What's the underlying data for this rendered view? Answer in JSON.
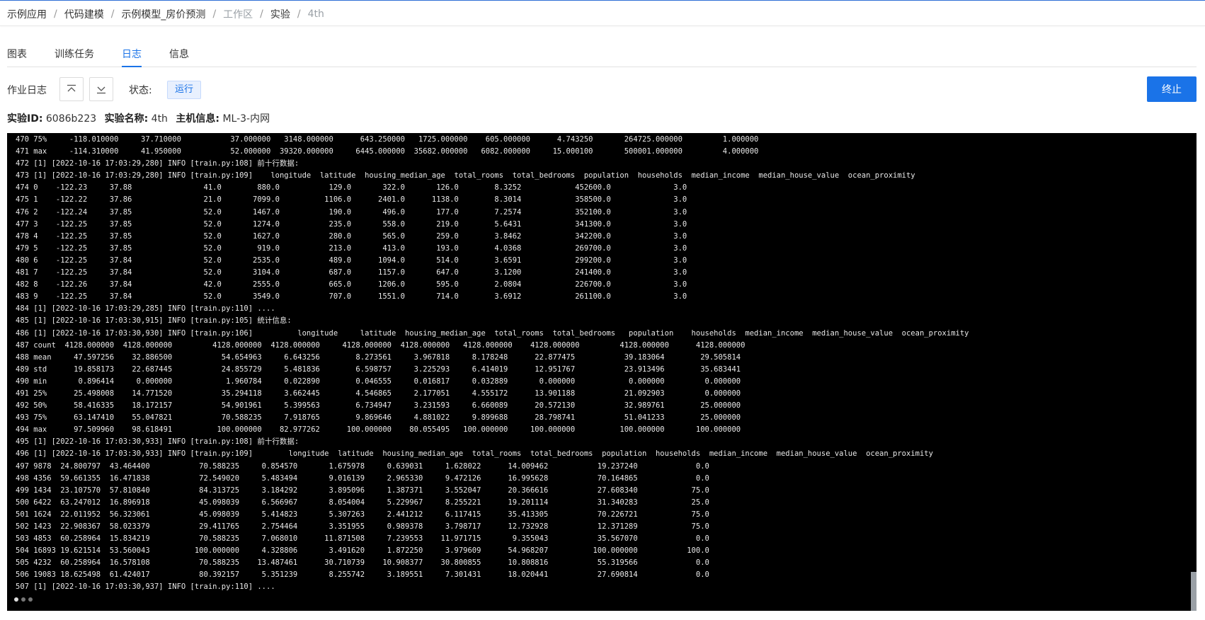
{
  "breadcrumb": [
    {
      "label": "示例应用",
      "muted": false
    },
    {
      "label": "代码建模",
      "muted": false
    },
    {
      "label": "示例模型_房价预测",
      "muted": false
    },
    {
      "label": "工作区",
      "muted": true
    },
    {
      "label": "实验",
      "muted": false
    },
    {
      "label": "4th",
      "muted": true
    }
  ],
  "breadcrumb_separator": "/",
  "tabs": [
    {
      "label": "图表",
      "active": false
    },
    {
      "label": "训练任务",
      "active": false
    },
    {
      "label": "日志",
      "active": true
    },
    {
      "label": "信息",
      "active": false
    }
  ],
  "toolbar": {
    "job_log_label": "作业日志",
    "scroll_top_icon": "scroll-to-top-icon",
    "scroll_bottom_icon": "scroll-to-bottom-icon",
    "status_label": "状态:",
    "status_value": "运行",
    "stop_label": "终止"
  },
  "experiment": {
    "id_label": "实验ID:",
    "id": "6086b223",
    "name_label": "实验名称:",
    "name": "4th",
    "host_label": "主机信息:",
    "host": "ML-3-内网"
  },
  "colors": {
    "accent": "#1a73e8",
    "console_bg": "#000000",
    "console_text": "#e8e8e8"
  },
  "log_lines": [
    "470 75%     -118.010000     37.710000           37.000000   3148.000000      643.250000   1725.000000    605.000000      4.743250       264725.000000         1.000000",
    "471 max     -114.310000     41.950000           52.000000  39320.000000     6445.000000  35682.000000   6082.000000     15.000100       500001.000000         4.000000",
    "472 [1] [2022-10-16 17:03:29,280] INFO [train.py:108] 前十行数据:",
    "473 [1] [2022-10-16 17:03:29,280] INFO [train.py:109]    longitude  latitude  housing_median_age  total_rooms  total_bedrooms  population  households  median_income  median_house_value  ocean_proximity",
    "474 0    -122.23     37.88                41.0        880.0           129.0       322.0       126.0        8.3252            452600.0              3.0",
    "475 1    -122.22     37.86                21.0       7099.0          1106.0      2401.0      1138.0        8.3014            358500.0              3.0",
    "476 2    -122.24     37.85                52.0       1467.0           190.0       496.0       177.0        7.2574            352100.0              3.0",
    "477 3    -122.25     37.85                52.0       1274.0           235.0       558.0       219.0        5.6431            341300.0              3.0",
    "478 4    -122.25     37.85                52.0       1627.0           280.0       565.0       259.0        3.8462            342200.0              3.0",
    "479 5    -122.25     37.85                52.0        919.0           213.0       413.0       193.0        4.0368            269700.0              3.0",
    "480 6    -122.25     37.84                52.0       2535.0           489.0      1094.0       514.0        3.6591            299200.0              3.0",
    "481 7    -122.25     37.84                52.0       3104.0           687.0      1157.0       647.0        3.1200            241400.0              3.0",
    "482 8    -122.26     37.84                42.0       2555.0           665.0      1206.0       595.0        2.0804            226700.0              3.0",
    "483 9    -122.25     37.84                52.0       3549.0           707.0      1551.0       714.0        3.6912            261100.0              3.0",
    "484 [1] [2022-10-16 17:03:29,285] INFO [train.py:110] ....",
    "485 [1] [2022-10-16 17:03:30,915] INFO [train.py:105] 统计信息:",
    "486 [1] [2022-10-16 17:03:30,930] INFO [train.py:106]          longitude     latitude  housing_median_age  total_rooms  total_bedrooms   population    households  median_income  median_house_value  ocean_proximity",
    "487 count  4128.000000  4128.000000         4128.000000  4128.000000     4128.000000  4128.000000   4128.000000    4128.000000         4128.000000      4128.000000",
    "488 mean     47.597256    32.886500           54.654963     6.643256        8.273561     3.967818     8.178248      22.877475           39.183064        29.505814",
    "489 std      19.858173    22.687445           24.855729     5.481836        6.598757     3.225293     6.414019      12.951767           23.913496        35.683441",
    "490 min       0.896414     0.000000            1.960784     0.022890        0.046555     0.016817     0.032889       0.000000            0.000000         0.000000",
    "491 25%      25.498008    14.771520           35.294118     3.662445        4.546865     2.177051     4.555172      13.901188           21.092903         0.000000",
    "492 50%      58.416335    18.172157           54.901961     5.399563        6.734947     3.231593     6.660089      20.572130           32.989761        25.000000",
    "493 75%      63.147410    55.047821           70.588235     7.918765        9.869646     4.881022     9.899688      28.798741           51.041233        25.000000",
    "494 max      97.509960    98.618491          100.000000    82.977262      100.000000    80.055495   100.000000     100.000000          100.000000       100.000000",
    "495 [1] [2022-10-16 17:03:30,933] INFO [train.py:108] 前十行数据:",
    "496 [1] [2022-10-16 17:03:30,933] INFO [train.py:109]        longitude  latitude  housing_median_age  total_rooms  total_bedrooms  population  households  median_income  median_house_value  ocean_proximity",
    "497 9878  24.800797  43.464400           70.588235     0.854570       1.675978     0.639031     1.628022      14.009462           19.237240             0.0",
    "498 4356  59.661355  16.471838           72.549020     5.483494       9.016139     2.965330     9.472126      16.995628           70.164865             0.0",
    "499 1434  23.107570  57.810840           84.313725     3.184292       3.895096     1.387371     3.552047      20.366616           27.608340            75.0",
    "500 6422  63.247012  16.896918           45.098039     6.566967       8.054004     5.229967     8.255221      19.201114           31.340283            25.0",
    "501 1624  22.011952  56.323061           45.098039     5.414823       5.307263     2.441212     6.117415      35.413305           70.226721            75.0",
    "502 1423  22.908367  58.023379           29.411765     2.754464       3.351955     0.989378     3.798717      12.732928           12.371289            75.0",
    "503 4853  60.258964  15.834219           70.588235     7.068010      11.871508     7.239553    11.971715       9.355043           35.567070             0.0",
    "504 16893 19.621514  53.560043          100.000000     4.328806       3.491620     1.872250     3.979609      54.968207          100.000000           100.0",
    "505 4232  60.258964  16.578108           70.588235    13.487461      30.710739    10.908377    30.800855      10.808816           55.319566             0.0",
    "506 19083 18.625498  61.424017           80.392157     5.351239       8.255742     3.189551     7.301431      18.020441           27.690814             0.0",
    "507 [1] [2022-10-16 17:03:30,937] INFO [train.py:110] ...."
  ]
}
